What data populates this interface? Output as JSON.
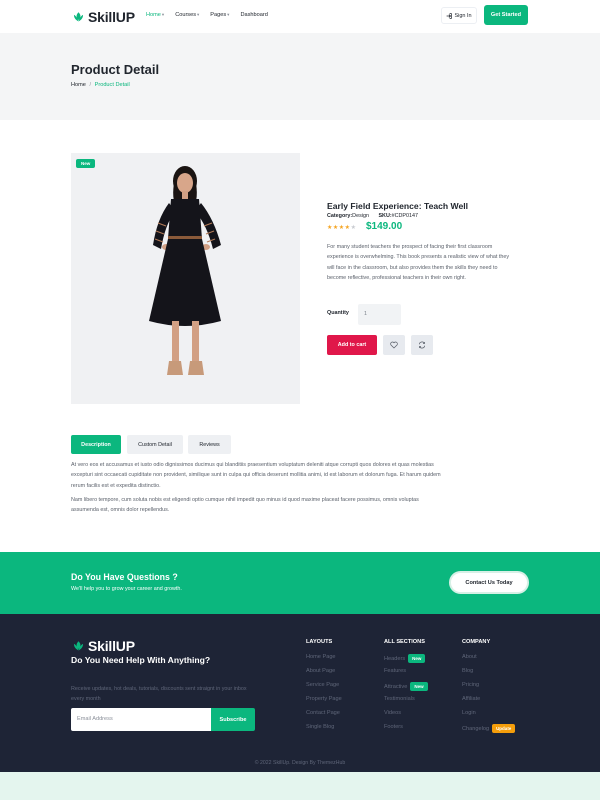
{
  "header": {
    "logo_text": "SkillUP",
    "nav": [
      {
        "label": "Home",
        "active": true,
        "dropdown": true
      },
      {
        "label": "Courses",
        "active": false,
        "dropdown": true
      },
      {
        "label": "Pages",
        "active": false,
        "dropdown": true
      },
      {
        "label": "Dashboard",
        "active": false,
        "dropdown": false
      }
    ],
    "sign_in_label": "Sign In",
    "get_started_label": "Get Started"
  },
  "hero": {
    "title": "Product Detail",
    "breadcrumb_home": "Home",
    "breadcrumb_sep": "/",
    "breadcrumb_current": "Product Detail"
  },
  "product": {
    "badge": "New",
    "title": "Early Field Experience: Teach Well",
    "category_label": "Category:",
    "category_value": "Design",
    "sku_label": "SKU:",
    "sku_value": "#CDP0147",
    "rating": 4,
    "rating_max": 5,
    "price": "$149.00",
    "description": "For many student teachers the prospect of facing their first classroom experience is overwhelming. This book presents a realistic view of what they will face in the classroom, but also provides them the skills they need to become reflective, professional teachers in their own right.",
    "quantity_label": "Quantity",
    "quantity_value": "1",
    "add_to_cart_label": "Add to cart"
  },
  "tabs": {
    "items": [
      "Description",
      "Custom Detail",
      "Reviews"
    ],
    "active_index": 0,
    "paragraph_1": "At vero eos et accusamus et iusto odio dignissimos ducimus qui blanditiis praesentium voluptatum deleniti atque corrupti quos dolores et quas molestias excepturi sint occaecati cupiditate non provident, similique sunt in culpa qui officia deserunt mollitia animi, id est laborum et dolorum fuga. Et harum quidem rerum facilis est et expedita distinctio.",
    "paragraph_2": "Nam libero tempore, cum soluta nobis est eligendi optio cumque nihil impedit quo minus id quod maxime placeat facere possimus, omnis voluptas assumenda est, omnis dolor repellendus."
  },
  "cta": {
    "title": "Do You Have Questions ?",
    "subtitle": "We'll help you to grow your career and growth.",
    "button_label": "Contact Us Today"
  },
  "footer": {
    "logo_text": "SkillUP",
    "help_title": "Do You Need Help With Anything?",
    "help_text": "Receive updates, hot deals, tutorials, discounts sent straignt in your inbox every month",
    "email_placeholder": "Email Address",
    "subscribe_label": "Subscribe",
    "columns": [
      {
        "title": "LAYOUTS",
        "links": [
          {
            "label": "Home Page"
          },
          {
            "label": "About Page"
          },
          {
            "label": "Service Page"
          },
          {
            "label": "Property Page"
          },
          {
            "label": "Contact Page"
          },
          {
            "label": "Single Blog"
          }
        ]
      },
      {
        "title": "ALL SECTIONS",
        "links": [
          {
            "label": "Headers",
            "tag": "New"
          },
          {
            "label": "Features"
          },
          {
            "label": "Attractive",
            "tag": "New"
          },
          {
            "label": "Testimonials"
          },
          {
            "label": "Videos"
          },
          {
            "label": "Footers"
          }
        ]
      },
      {
        "title": "COMPANY",
        "links": [
          {
            "label": "About"
          },
          {
            "label": "Blog"
          },
          {
            "label": "Pricing"
          },
          {
            "label": "Affiliate"
          },
          {
            "label": "Login"
          },
          {
            "label": "Changelog",
            "tag": "Update"
          }
        ]
      }
    ],
    "copyright": "© 2022 SkillUp. Design By ThemezHub"
  },
  "colors": {
    "brand_green": "#0bb77e",
    "add_to_cart_red": "#e0174a",
    "footer_bg": "#1e2436",
    "tag_new": "#0bb77e",
    "tag_update": "#f59e0b",
    "star_filled": "#f5a524"
  },
  "icons": {
    "logo": "leaf-logo-icon",
    "sign_in": "sign-in-icon",
    "wishlist": "heart-icon",
    "compare": "refresh-icon"
  }
}
